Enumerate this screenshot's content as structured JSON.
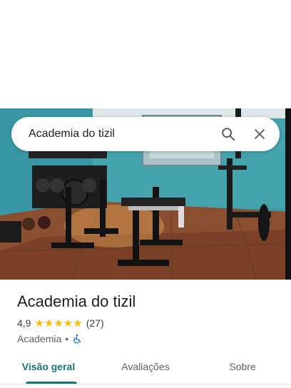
{
  "search": {
    "query": "Academia do tizil"
  },
  "place": {
    "name": "Academia do tizil",
    "rating": "4,9",
    "stars": "★★★★★",
    "review_count": "(27)",
    "category": "Academia",
    "separator": "•",
    "accessibility_icon": "wheelchair-icon"
  },
  "tabs": [
    {
      "label": "Visão geral",
      "active": true
    },
    {
      "label": "Avaliações",
      "active": false
    },
    {
      "label": "Sobre",
      "active": false
    }
  ],
  "colors": {
    "accent": "#1a7377",
    "star": "#fbbc04",
    "accessibility": "#1a73e8"
  }
}
